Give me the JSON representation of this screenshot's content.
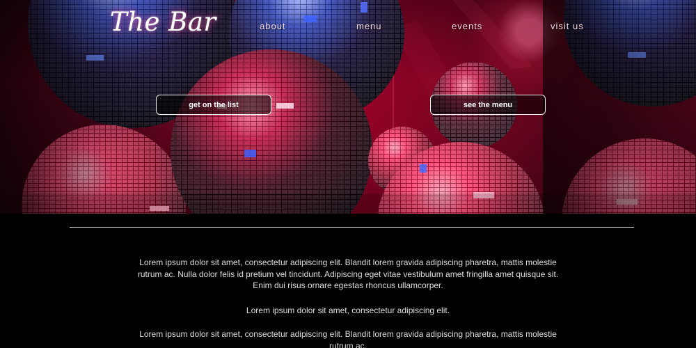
{
  "site": {
    "logo": "The Bar"
  },
  "nav": {
    "about": "about",
    "menu": "menu",
    "events": "events",
    "visit": "visit us"
  },
  "hero": {
    "primary_cta": "get on the list",
    "secondary_cta": "see the menu"
  },
  "content": {
    "paragraph_1": "Lorem ipsum dolor sit amet, consectetur adipiscing elit. Blandit lorem gravida adipiscing pharetra, mattis molestie rutrum ac. Nulla dolor felis id pretium vel tincidunt. Adipiscing eget vitae vestibulum amet fringilla amet quisque sit. Enim dui risus ornare egestas rhoncus ullamcorper.",
    "paragraph_2": "Lorem ipsum dolor sit amet, consectetur adipiscing elit.",
    "paragraph_3": "Lorem ipsum dolor sit amet, consectetur adipiscing elit. Blandit lorem gravida adipiscing pharetra, mattis molestie rutrum ac."
  },
  "colors": {
    "background": "#000000",
    "hero_dark_red": "#2c0311",
    "hero_red": "#5a061d",
    "accent_glow": "#ff3a7a",
    "text": "#dfdfdf"
  }
}
